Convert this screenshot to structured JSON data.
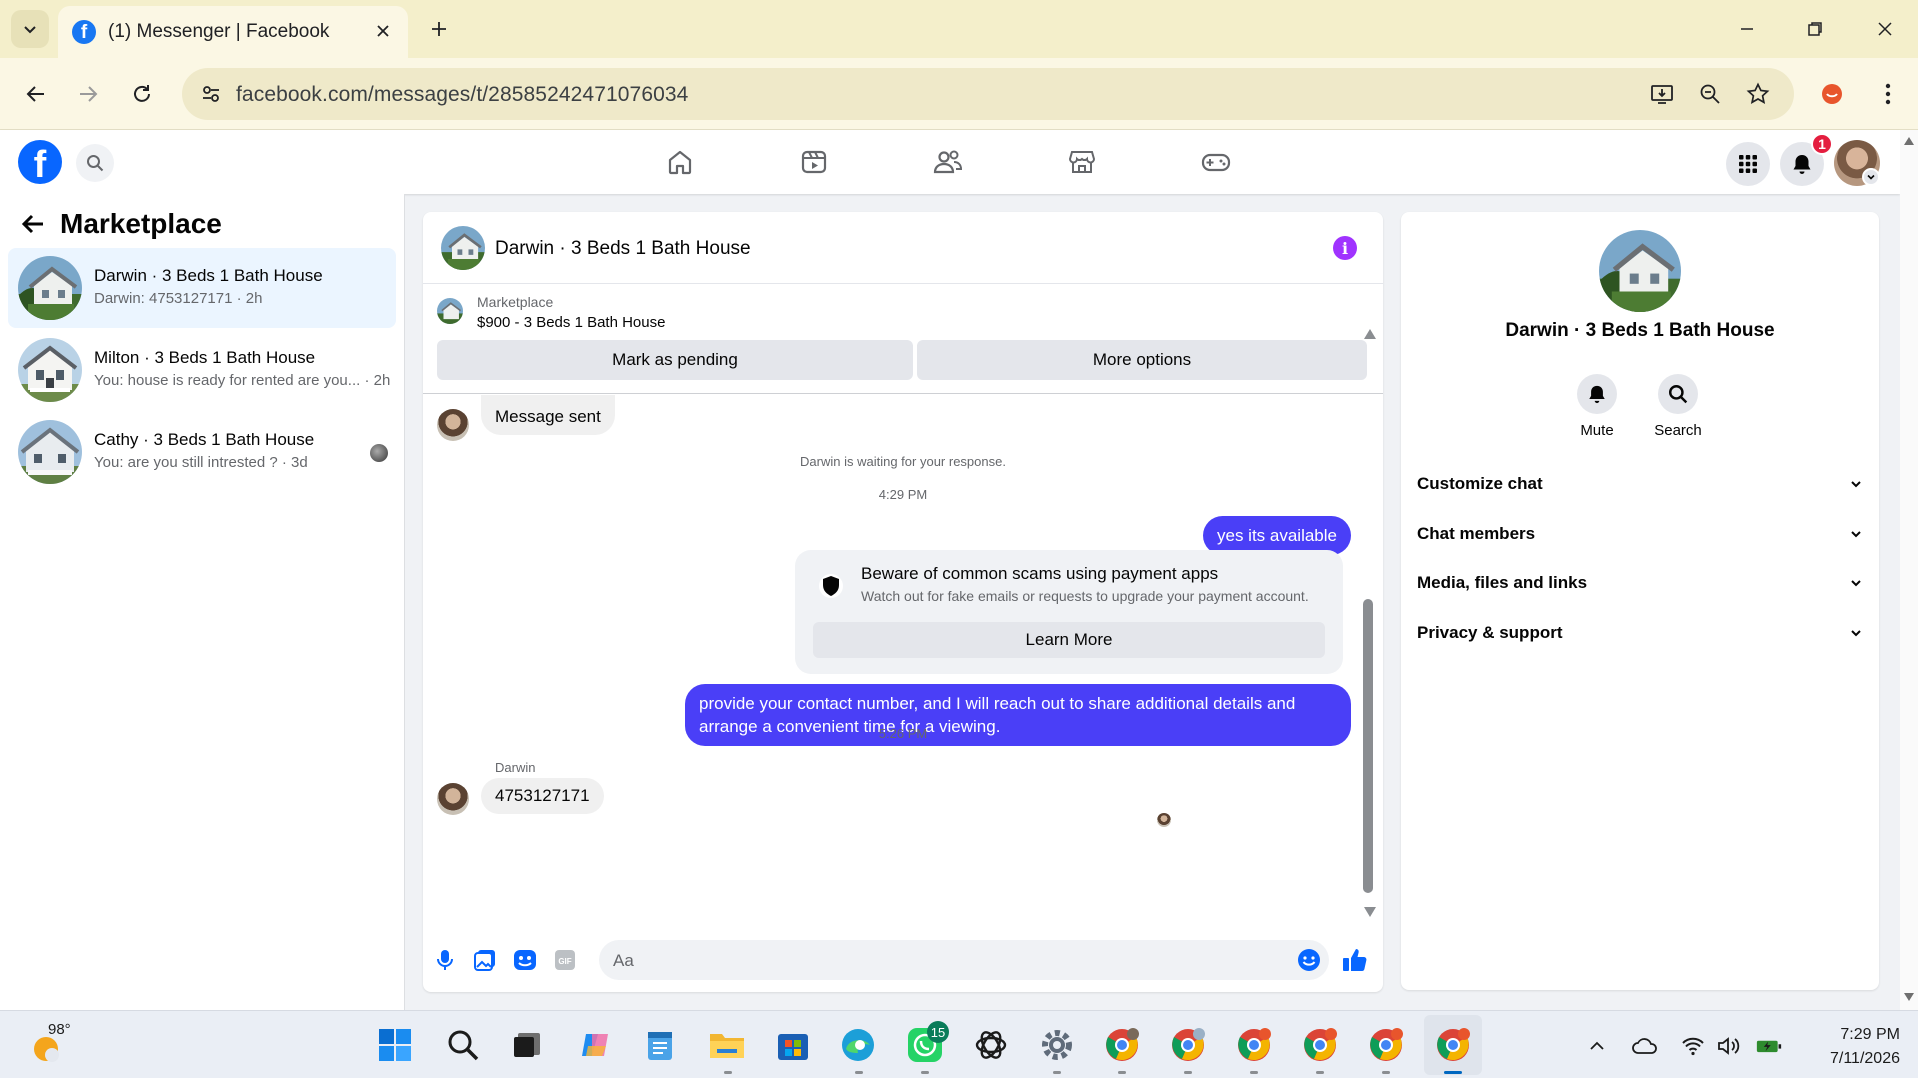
{
  "browser": {
    "tab_title": "(1) Messenger | Facebook",
    "url": "facebook.com/messages/t/28585242471076034"
  },
  "fb_header": {
    "notification_count": "1"
  },
  "left_panel": {
    "title": "Marketplace",
    "conversations": [
      {
        "name": "Darwin · 3 Beds 1 Bath House",
        "preview": "Darwin: 4753127171 · 2h",
        "active": true
      },
      {
        "name": "Milton · 3 Beds 1 Bath House",
        "preview": "You: house is ready for rented are you... · 2h",
        "active": false
      },
      {
        "name": "Cathy · 3 Beds 1 Bath House",
        "preview": "You: are you still intrested ? · 3d",
        "active": false
      }
    ]
  },
  "chat": {
    "title": "Darwin · 3 Beds 1 Bath House",
    "listing_label": "Marketplace",
    "listing_title": "$900 - 3 Beds 1 Bath House",
    "btn_pending": "Mark as pending",
    "btn_more": "More options",
    "msg_sent": "Message sent",
    "waiting": "Darwin is waiting for your response.",
    "time1": "4:29 PM",
    "out1": "yes its available",
    "scam_title": "Beware of common scams using payment apps",
    "scam_sub": "Watch out for fake emails or requests to upgrade your payment account.",
    "learn_more": "Learn More",
    "out2": "provide your contact number, and I will reach out to share additional details and arrange a convenient time for a viewing.",
    "time2": "5:26 PM",
    "sender": "Darwin",
    "in2": "4753127171",
    "composer_placeholder": "Aa"
  },
  "info_panel": {
    "name": "Darwin · 3 Beds 1 Bath House",
    "mute": "Mute",
    "search": "Search",
    "sections": [
      "Customize chat",
      "Chat members",
      "Media, files and links",
      "Privacy & support"
    ]
  },
  "taskbar": {
    "temperature": "98°",
    "whatsapp_badge": "15",
    "time": "7:29 PM",
    "date": "7/11/2026"
  },
  "colors": {
    "fb_blue": "#0866ff",
    "outgoing_bubble": "#4a3ff7",
    "info_purple": "#a033ff",
    "tab_bar": "#f4efcb"
  }
}
